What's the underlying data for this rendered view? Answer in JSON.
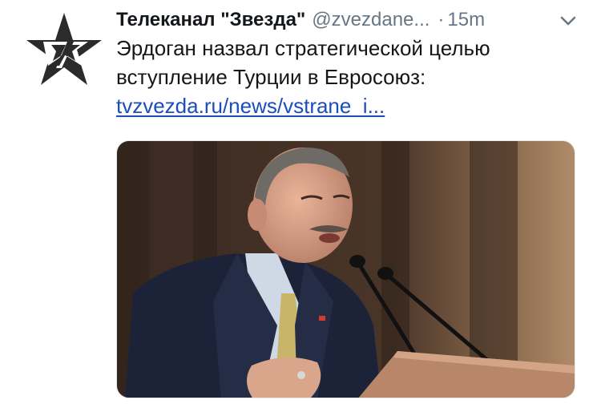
{
  "tweet": {
    "author": {
      "display_name": "Телеканал \"Звезда\"",
      "handle": "@zvezdane...",
      "avatar_icon": "red-star-logo-icon"
    },
    "separator": "·",
    "timestamp": "15m",
    "menu_icon": "chevron-down-icon",
    "text_lines": [
      "Эрдоган назвал стратегической целью",
      "вступление Турции в Евросоюз:"
    ],
    "link_text": "tvzvezda.ru/news/vstrane_i...",
    "colors": {
      "name": "#14171a",
      "secondary": "#657786",
      "link": "#1b4dbf",
      "logo": "#2b2b2b"
    }
  }
}
